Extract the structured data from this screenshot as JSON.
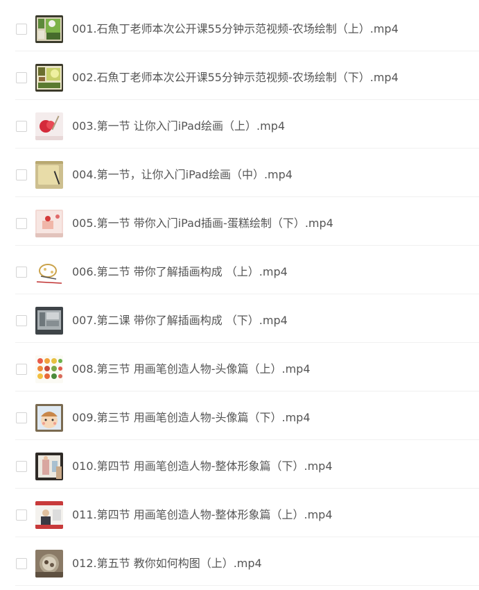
{
  "files": [
    {
      "name": "001.石魚丁老师本次公开课55分钟示范视频-农场绘制（上）.mp4",
      "thumb_icon": "video-thumbnail-farm-icon"
    },
    {
      "name": "002.石魚丁老师本次公开课55分钟示范视频-农场绘制（下）.mp4",
      "thumb_icon": "video-thumbnail-farm-icon"
    },
    {
      "name": "003.第一节 让你入门iPad绘画（上）.mp4",
      "thumb_icon": "video-thumbnail-strawberry-icon"
    },
    {
      "name": "004.第一节，让你入门iPad绘画（中）.mp4",
      "thumb_icon": "video-thumbnail-tablet-icon"
    },
    {
      "name": "005.第一节 带你入门iPad插画-蛋糕绘制（下）.mp4",
      "thumb_icon": "video-thumbnail-cake-icon"
    },
    {
      "name": "006.第二节 带你了解插画构成 （上）.mp4",
      "thumb_icon": "video-thumbnail-sketch-icon"
    },
    {
      "name": "007.第二课 带你了解插画构成 （下）.mp4",
      "thumb_icon": "video-thumbnail-screen-icon"
    },
    {
      "name": "008.第三节 用画笔创造人物-头像篇（上）.mp4",
      "thumb_icon": "video-thumbnail-faces-icon"
    },
    {
      "name": "009.第三节 用画笔创造人物-头像篇（下）.mp4",
      "thumb_icon": "video-thumbnail-face-icon"
    },
    {
      "name": "010.第四节 用画笔创造人物-整体形象篇（下）.mp4",
      "thumb_icon": "video-thumbnail-figure-icon"
    },
    {
      "name": "011.第四节 用画笔创造人物-整体形象篇（上）.mp4",
      "thumb_icon": "video-thumbnail-presenter-icon"
    },
    {
      "name": "012.第五节 教你如何构图（上）.mp4",
      "thumb_icon": "video-thumbnail-composition-icon"
    }
  ],
  "colors": {
    "text": "#555555",
    "divider": "#f0f0f0",
    "checkbox_border": "#d4d4d4"
  }
}
